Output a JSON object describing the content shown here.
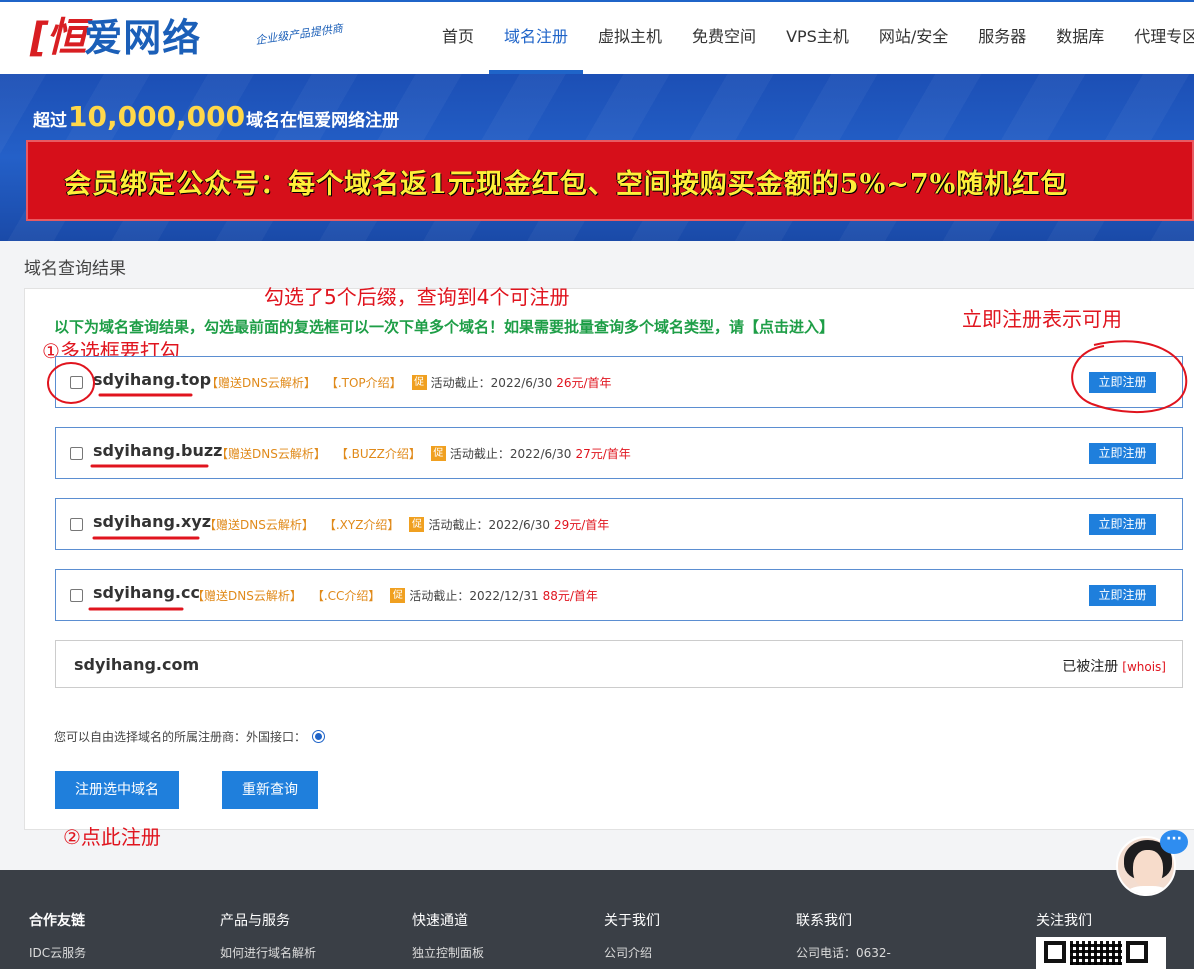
{
  "header": {
    "logo_mark": "[恒",
    "logo_text": "爱网络",
    "slogan": "企业级产品提供商",
    "nav": [
      {
        "label": "首页",
        "active": false
      },
      {
        "label": "域名注册",
        "active": true
      },
      {
        "label": "虚拟主机",
        "active": false
      },
      {
        "label": "免费空间",
        "active": false
      },
      {
        "label": "VPS主机",
        "active": false
      },
      {
        "label": "网站/安全",
        "active": false
      },
      {
        "label": "服务器",
        "active": false
      },
      {
        "label": "数据库",
        "active": false
      },
      {
        "label": "代理专区",
        "active": false
      }
    ]
  },
  "banner": {
    "prefix": "超过",
    "number": "10,000,000",
    "suffix": "域名在恒爱网络注册",
    "promo": "会员绑定公众号：每个域名返1元现金红包、空间按购买金额的5%~7%随机红包"
  },
  "results": {
    "section_title": "域名查询结果",
    "intro": "以下为域名查询结果，勾选最前面的复选框可以一次下单多个域名！如果需要批量查询多个域名类型，请【点击进入】",
    "gift": "【赠送DNS云解析】",
    "badge": "促",
    "register_label": "立即注册",
    "available": [
      {
        "domain": "sdyihang.top",
        "intro": "【.TOP介绍】",
        "deadline": "活动截止：2022/6/30",
        "price": "26元/首年"
      },
      {
        "domain": "sdyihang.buzz",
        "intro": "【.BUZZ介绍】",
        "deadline": "活动截止：2022/6/30",
        "price": "27元/首年"
      },
      {
        "domain": "sdyihang.xyz",
        "intro": "【.XYZ介绍】",
        "deadline": "活动截止：2022/6/30",
        "price": "29元/首年"
      },
      {
        "domain": "sdyihang.cc",
        "intro": "【.CC介绍】",
        "deadline": "活动截止：2022/12/31",
        "price": "88元/首年"
      }
    ],
    "taken": {
      "domain": "sdyihang.com",
      "status": "已被注册",
      "whois": "[whois]"
    },
    "registrar_label": "您可以自由选择域名的所属注册商：",
    "registrar_option": "外国接口：",
    "buttons": {
      "register_selected": "注册选中域名",
      "requery": "重新查询"
    }
  },
  "annotations": {
    "selected": "勾选了5个后缀，查询到4个可注册",
    "register_hint": "立即注册表示可用",
    "checkbox_hint": "①多选框要打勾",
    "click_hint": "②点此注册"
  },
  "footer": {
    "columns": [
      {
        "title": "合作友链",
        "link": "IDC云服务"
      },
      {
        "title": "产品与服务",
        "link": "如何进行域名解析"
      },
      {
        "title": "快速通道",
        "link": "独立控制面板"
      },
      {
        "title": "关于我们",
        "link": "公司介绍"
      },
      {
        "title": "联系我们",
        "link": "公司电话：0632-"
      },
      {
        "title": "关注我们",
        "link": ""
      }
    ]
  },
  "chat": {
    "bubble": "···"
  },
  "colors": {
    "primary": "#1f64c8",
    "button": "#1f7fdc",
    "annotation": "#e0141e",
    "intro": "#1e9e47",
    "promo_bg": "#d60f1a",
    "promo_text": "#ffef3a"
  }
}
